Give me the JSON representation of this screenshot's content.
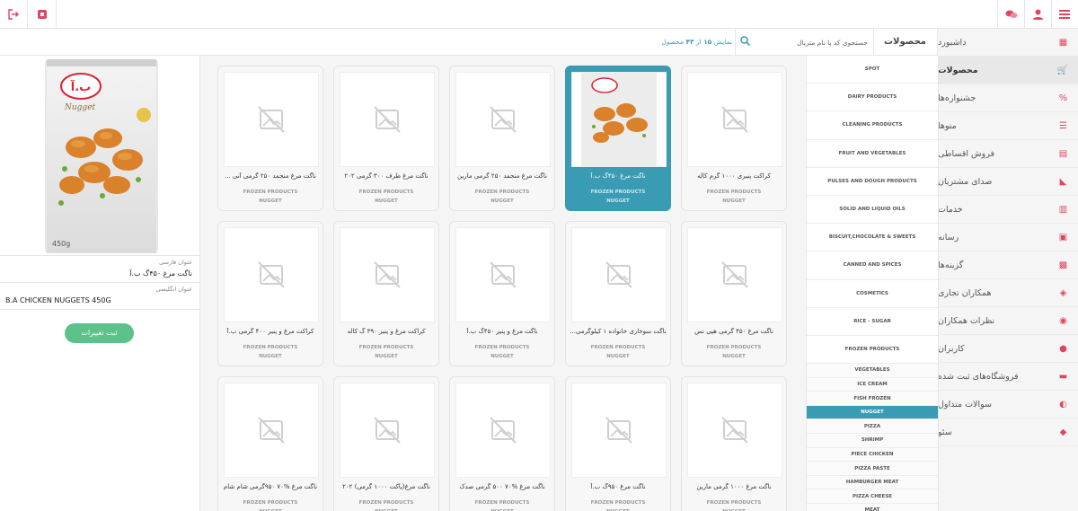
{
  "topbar": {
    "icons": [
      "logout-icon",
      "app-icon",
      "user-icon",
      "chat-icon",
      "menu-icon"
    ]
  },
  "sidebar": {
    "items": [
      {
        "label": "داشبورد",
        "icon": "dashboard-icon"
      },
      {
        "label": "محصولات",
        "icon": "cart-icon",
        "active": true
      },
      {
        "label": "جشنواره‌ها",
        "icon": "percent-icon"
      },
      {
        "label": "منوها",
        "icon": "menu-icon",
        "chevron": true
      },
      {
        "label": "فروش اقساطی",
        "icon": "doc-icon"
      },
      {
        "label": "صدای مشتریان",
        "icon": "megaphone-icon"
      },
      {
        "label": "خدمات",
        "icon": "services-icon"
      },
      {
        "label": "رسانه",
        "icon": "media-icon"
      },
      {
        "label": "گزینه‌ها",
        "icon": "options-icon"
      },
      {
        "label": "همکاران تجاری",
        "icon": "handshake-icon"
      },
      {
        "label": "نظرات همکاران",
        "icon": "comments-icon"
      },
      {
        "label": "کاربران",
        "icon": "users-icon"
      },
      {
        "label": "فروشگاه‌های ثبت شده",
        "icon": "store-icon"
      },
      {
        "label": "سوالات متداول",
        "icon": "faq-icon"
      },
      {
        "label": "سئو",
        "icon": "seo-icon"
      }
    ]
  },
  "header": {
    "title": "محصولات",
    "search_placeholder": "جستجوی کد یا نام متریال",
    "count_prefix": "نمایش",
    "count_shown": "۱۵",
    "count_of": "از",
    "count_total": "۴۳",
    "count_suffix": "محصول"
  },
  "categories": [
    "SPOT",
    "DAIRY PRODUCTS",
    "CLEANING PRODUCTS",
    "FRUIT AND VEGETABLES",
    "PULSES AND DOUGH PRODUCTS",
    "SOLID AND LIQUID OILS",
    "BISCUIT,CHOCOLATE & SWEETS",
    "CANNED AND SPICES",
    "COSMETICS",
    "RICE - SUGAR",
    "FROZEN PRODUCTS"
  ],
  "subcategories": [
    {
      "label": "VEGETABLES"
    },
    {
      "label": "ICE CREAM"
    },
    {
      "label": "FISH FROZEN"
    },
    {
      "label": "NUGGET",
      "active": true
    },
    {
      "label": "PIZZA"
    },
    {
      "label": "SHRIMP"
    },
    {
      "label": "PIECE CHICKEN"
    },
    {
      "label": "PIZZA PASTE"
    },
    {
      "label": "HAMBURGER MEAT"
    },
    {
      "label": "PIZZA CHEESE"
    },
    {
      "label": "MEAT"
    }
  ],
  "products": [
    {
      "name": "کراکت پنیری ۱۰۰۰ گرم کاله",
      "cat": "FROZEN PRODUCTS",
      "sub": "NUGGET"
    },
    {
      "name": "ناگت مرغ ۴۵۰گ ب.آ",
      "cat": "FROZEN PRODUCTS",
      "sub": "NUGGET",
      "selected": true
    },
    {
      "name": "ناگت مرغ منجمد ۲۵۰ گرمی مارین",
      "cat": "FROZEN PRODUCTS",
      "sub": "NUGGET"
    },
    {
      "name": "ناگت مرغ ظرف ۳۰۰ گرمی ۲۰۲",
      "cat": "FROZEN PRODUCTS",
      "sub": "NUGGET"
    },
    {
      "name": "ناگت مرغ منجمد ۲۵۰ گرمی آنی ...",
      "cat": "FROZEN PRODUCTS",
      "sub": "NUGGET"
    },
    {
      "name": "ناگت مرغ ۴۵۰ گرمی هپی نس",
      "cat": "FROZEN PRODUCTS",
      "sub": "NUGGET"
    },
    {
      "name": "ناگت سوخاری خانواده ۱ کیلوگرمی...",
      "cat": "FROZEN PRODUCTS",
      "sub": "NUGGET"
    },
    {
      "name": "ناگت مرغ و پنیر ۴۵۰گ ب.آ",
      "cat": "FROZEN PRODUCTS",
      "sub": "NUGGET"
    },
    {
      "name": "کراکت مرغ و پنیر ۳۹۰ گ کاله",
      "cat": "FROZEN PRODUCTS",
      "sub": "NUGGET"
    },
    {
      "name": "کراکت مرغ و پنیر ۴۰۰ گرمی ب.آ",
      "cat": "FROZEN PRODUCTS",
      "sub": "NUGGET"
    },
    {
      "name": "ناگت مرغ ۱۰۰۰ گرمی مارین",
      "cat": "FROZEN PRODUCTS",
      "sub": "NUGGET"
    },
    {
      "name": "ناگت مرغ ۹۵۰گ ب.آ",
      "cat": "FROZEN PRODUCTS",
      "sub": "NUGGET"
    },
    {
      "name": "ناگت مرغ %۷۰ ۵۰۰ گرمی صدک",
      "cat": "FROZEN PRODUCTS",
      "sub": "NUGGET"
    },
    {
      "name": "ناگت مرغ(پاکت ۱۰۰۰ گرمی) ۲۰۲",
      "cat": "FROZEN PRODUCTS",
      "sub": "NUGGET"
    },
    {
      "name": "ناگت مرغ %۷۰ ۹۵۰گرمی شام شام",
      "cat": "FROZEN PRODUCTS",
      "sub": "NUGGET"
    }
  ],
  "detail": {
    "fa_label": "عنوان فارسی",
    "fa_value": "ناگت مرغ ۴۵۰گ ب.آ",
    "en_label": "عنوان انگلیسی",
    "en_value": "B.A CHICKEN NUGGETS 450G",
    "save_label": "ثبت تغییرات",
    "pack_brand": "ب.آ",
    "pack_name": "Nugget",
    "pack_weight": "450g"
  },
  "colors": {
    "accent": "#e0455e",
    "selected": "#3a9bb5",
    "save": "#5cc28a"
  }
}
